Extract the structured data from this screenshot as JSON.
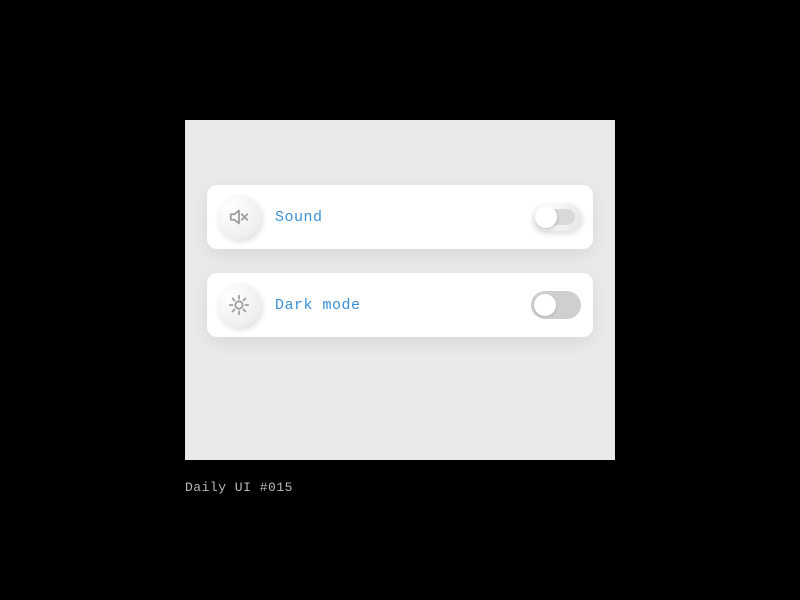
{
  "settings": [
    {
      "label": "Sound",
      "icon": "speaker-muted",
      "toggle_on": false
    },
    {
      "label": "Dark mode",
      "icon": "sun",
      "toggle_on": false
    }
  ],
  "caption": "Daily UI #015",
  "colors": {
    "accent": "#3b8fd6",
    "panel_bg": "#eaeaea",
    "row_bg": "#ffffff",
    "icon_stroke": "#9e9e9e"
  }
}
